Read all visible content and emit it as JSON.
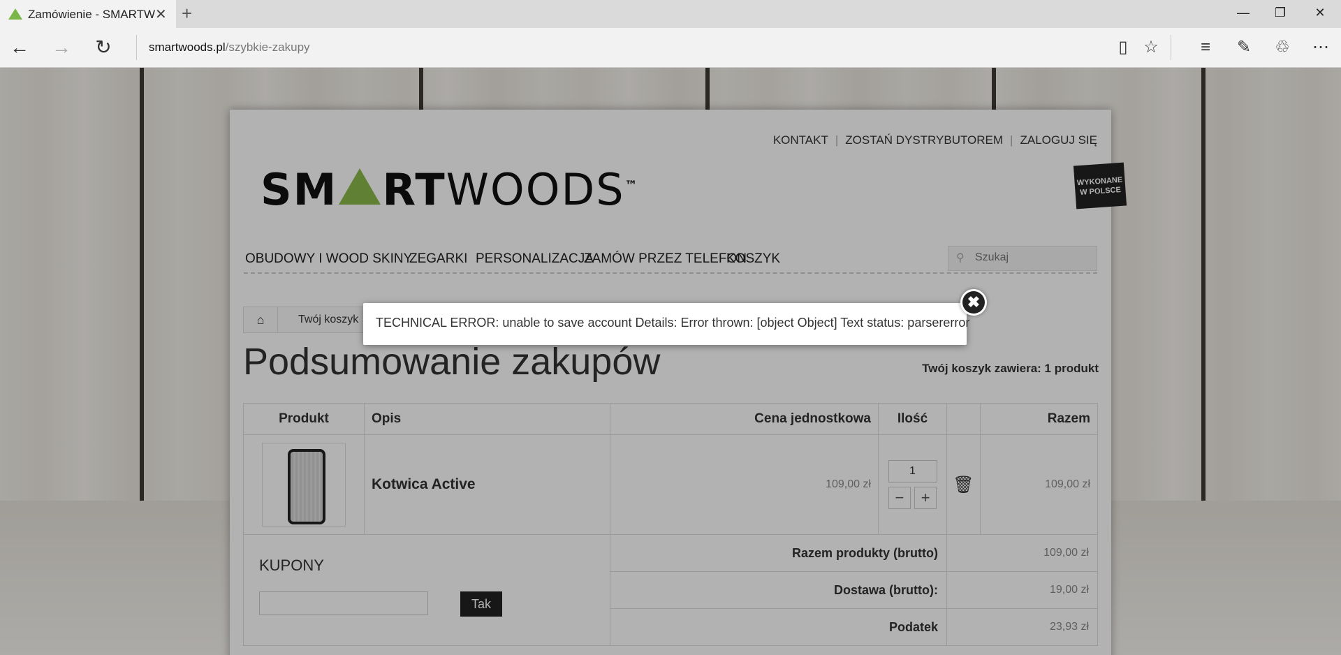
{
  "browser": {
    "tab_title": "Zamówienie - SMARTW",
    "tab_close": "✕",
    "new_tab": "+",
    "url_host": "smartwoods.pl",
    "url_path": "/szybkie-zakupy",
    "win_minimize": "—",
    "win_restore": "❐",
    "win_close": "✕",
    "icons": {
      "back": "←",
      "forward": "→",
      "refresh": "↻",
      "reading": "▯",
      "favorite": "☆",
      "hub": "≡",
      "note": "✎",
      "share": "♲",
      "more": "⋯"
    }
  },
  "site": {
    "toplinks": [
      "KONTAKT",
      "ZOSTAŃ DYSTRYBUTOREM",
      "ZALOGUJ SIĘ"
    ],
    "logo_bold": "SM",
    "logo_bold2": "RT",
    "logo_light": "WOODS",
    "logo_tm": "™",
    "badge_line1": "WYKONANE",
    "badge_line2": "W POLSCE",
    "nav": [
      "OBUDOWY I WOOD SKINY",
      "ZEGARKI",
      "PERSONALIZACJA",
      "ZAMÓW PRZEZ TELEFON",
      "KOSZYK"
    ],
    "search_placeholder": "Szukaj"
  },
  "breadcrumb": {
    "home_icon": "⌂",
    "current": "Twój koszyk"
  },
  "summary": {
    "title": "Podsumowanie zakupów",
    "cart_count": "Twój koszyk zawiera: 1 produkt"
  },
  "table": {
    "headers": [
      "Produkt",
      "Opis",
      "Cena jednostkowa",
      "Ilość",
      "",
      "Razem"
    ],
    "row": {
      "name": "Kotwica Active",
      "unit_price": "109,00 zł",
      "qty": "1",
      "minus": "−",
      "plus": "+",
      "trash": "🗑",
      "total": "109,00 zł"
    },
    "totals": [
      {
        "label": "Razem produkty (brutto)",
        "value": "109,00 zł"
      },
      {
        "label": "Dostawa (brutto):",
        "value": "19,00 zł"
      },
      {
        "label": "Podatek",
        "value": "23,93 zł"
      }
    ]
  },
  "coupons": {
    "title": "KUPONY",
    "button": "Tak"
  },
  "modal": {
    "message": "TECHNICAL ERROR: unable to save account Details: Error thrown: [object Object] Text status: parsererror",
    "close": "✖"
  }
}
